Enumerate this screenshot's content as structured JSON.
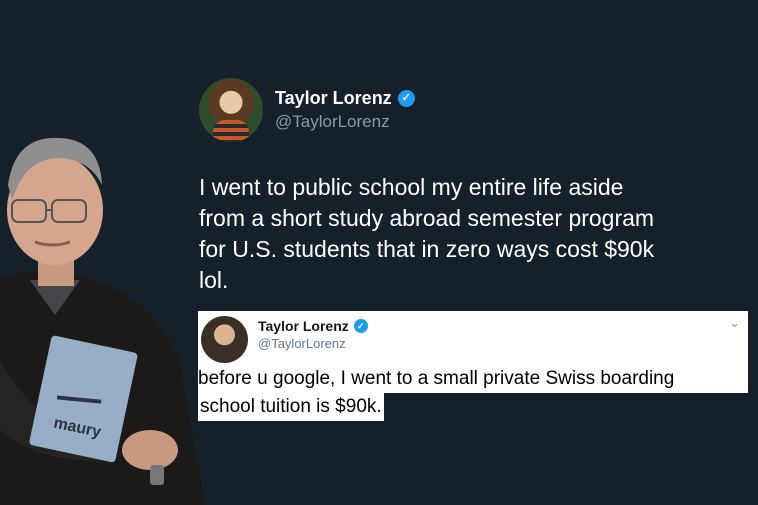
{
  "main_tweet": {
    "name": "Taylor Lorenz",
    "handle": "@TaylorLorenz",
    "text": "I went to public school my entire life aside from a short study abroad semester program for U.S. students that in zero ways cost $90k lol."
  },
  "quoted_tweet": {
    "name": "Taylor Lorenz",
    "handle": "@TaylorLorenz",
    "line1": "before u google, I went to a small private Swiss boarding",
    "line2": "school tuition is $90k."
  },
  "colors": {
    "background": "#15202b",
    "verified": "#1d9bf0"
  },
  "card_logo": "maury"
}
